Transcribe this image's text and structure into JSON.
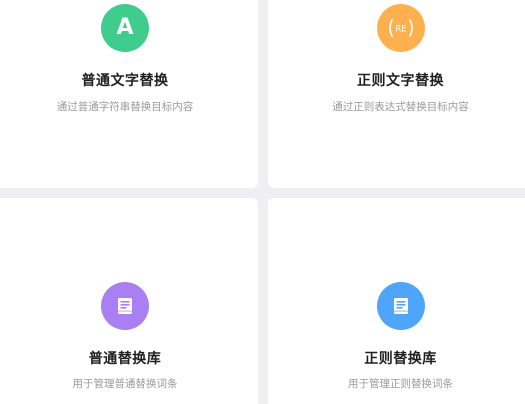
{
  "cards": [
    {
      "title": "普通文字替换",
      "desc": "通过普通字符串替换目标内容",
      "icon": "letter-a-icon",
      "icon_text": "A",
      "color": "#3fcc8c"
    },
    {
      "title": "正则文字替换",
      "desc": "通过正则表达式替换目标内容",
      "icon": "regex-icon",
      "icon_text": "(RE)",
      "color": "#ffb04e"
    },
    {
      "title": "普通替换库",
      "desc": "用于管理普通替换词条",
      "icon": "book-icon",
      "color": "#a97ff2"
    },
    {
      "title": "正则替换库",
      "desc": "用于管理正则替换词条",
      "icon": "book-icon",
      "color": "#4ea5f9"
    }
  ]
}
